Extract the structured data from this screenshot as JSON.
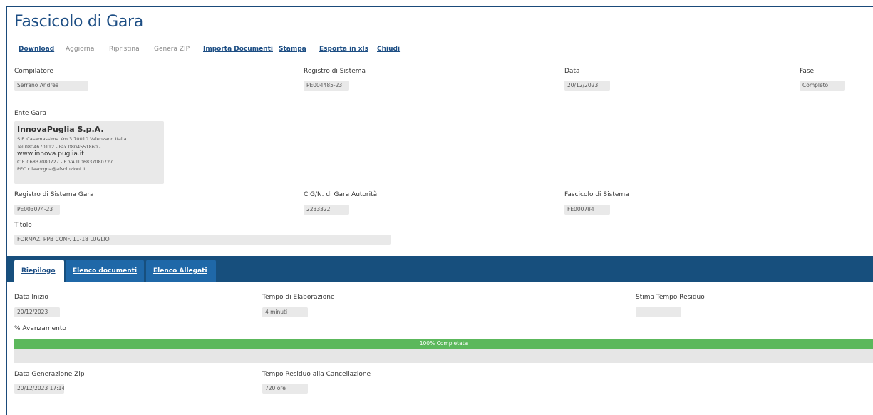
{
  "page_title": "Fascicolo di Gara",
  "toolbar": {
    "download": "Download",
    "aggiorna": "Aggiorna",
    "ripristina": "Ripristina",
    "genera_zip": "Genera ZIP",
    "importa_documenti": "Importa Documenti",
    "stampa": "Stampa",
    "esporta_xls": "Esporta in xls",
    "chiudi": "Chiudi"
  },
  "header_fields": {
    "compilatore_label": "Compilatore",
    "compilatore_value": "Serrano Andrea",
    "registro_label": "Registro di Sistema",
    "registro_value": "PE004485-23",
    "data_label": "Data",
    "data_value": "20/12/2023",
    "fase_label": "Fase",
    "fase_value": "Completo"
  },
  "ente": {
    "label": "Ente Gara",
    "name": "InnovaPuglia S.p.A.",
    "address": "S.P. Casamassima Km.3 70010 Valenzano Italia",
    "phone": "Tel 0804670112 - Fax 0804551860 -",
    "website": "www.innova.puglia.it",
    "fiscal": "C.F. 06837080727 - P.IVA IT06837080727",
    "pec": "PEC c.lavorgna@afsoluzioni.it"
  },
  "gara_fields": {
    "registro_gara_label": "Registro di Sistema Gara",
    "registro_gara_value": "PE003074-23",
    "cig_label": "CIG/N. di Gara Autorità",
    "cig_value": "2233322",
    "fascicolo_label": "Fascicolo di Sistema",
    "fascicolo_value": "FE000784",
    "titolo_label": "Titolo",
    "titolo_value": "FORMAZ. PPB CONF. 11-18 LUGLIO"
  },
  "tabs": {
    "riepilogo": "Riepilogo",
    "elenco_documenti": "Elenco documenti",
    "elenco_allegati": "Elenco Allegati"
  },
  "riepilogo": {
    "data_inizio_label": "Data Inizio",
    "data_inizio_value": "20/12/2023",
    "tempo_elab_label": "Tempo di Elaborazione",
    "tempo_elab_value": "4 minuti",
    "stima_label": "Stima Tempo Residuo",
    "stima_value": "",
    "avanzamento_label": "% Avanzamento",
    "progress_percent": 100,
    "progress_text": "100% Completata",
    "data_zip_label": "Data Generazione Zip",
    "data_zip_value": "20/12/2023 17:14",
    "tempo_canc_label": "Tempo Residuo alla Cancellazione",
    "tempo_canc_value": "720 ore"
  },
  "colors": {
    "accent": "#1d4e84",
    "tabbar": "#174f7d",
    "tab_inactive": "#1f68a8",
    "progress": "#5cb85c"
  }
}
